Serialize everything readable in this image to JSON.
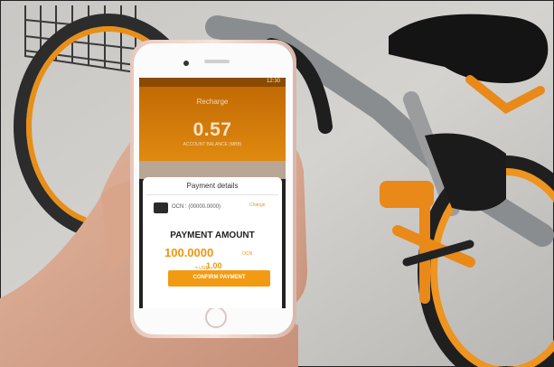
{
  "phone_app": {
    "status_time": "12:30",
    "header_title": "Recharge",
    "balance": "0.57",
    "balance_label": "ACCOUNT BALANCE (MBB)",
    "payment_title": "Payment details",
    "ocn_line": "OCN : (00000.0000)",
    "change_link": "Change",
    "payment_amount_label": "PAYMENT AMOUNT",
    "payment_amount": "100.0000",
    "payment_unit": "OCN",
    "usd_prefix": "= US$",
    "usd_amount": "1.00",
    "confirm_button": "CONFIRM PAYMENT"
  }
}
